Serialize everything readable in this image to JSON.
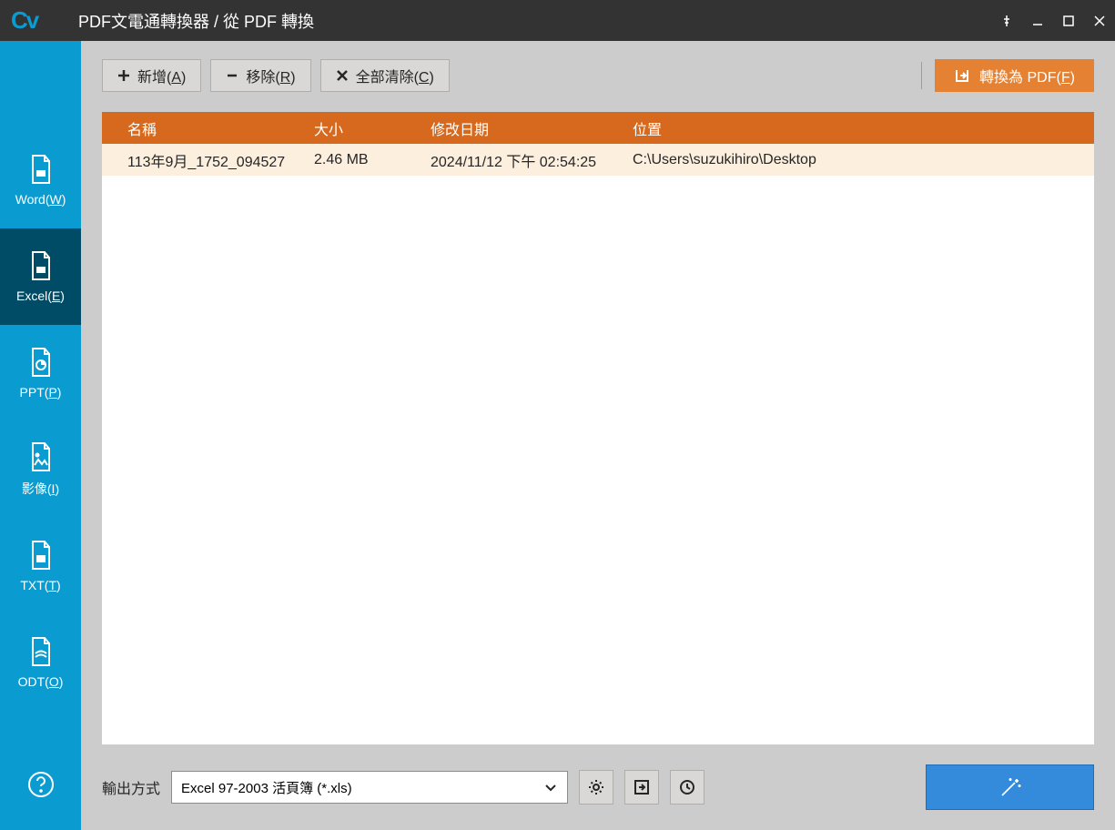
{
  "titlebar": {
    "logo": "Cv",
    "title": "PDF文電通轉換器 / 從 PDF 轉換"
  },
  "sidebar": {
    "items": [
      {
        "label": "Word(",
        "key": "W",
        "tail": ")",
        "icon": "word"
      },
      {
        "label": "Excel(",
        "key": "E",
        "tail": ")",
        "icon": "excel",
        "active": true
      },
      {
        "label": "PPT(",
        "key": "P",
        "tail": ")",
        "icon": "ppt"
      },
      {
        "label": "影像(",
        "key": "I",
        "tail": ")",
        "icon": "image"
      },
      {
        "label": "TXT(",
        "key": "T",
        "tail": ")",
        "icon": "txt"
      },
      {
        "label": "ODT(",
        "key": "O",
        "tail": ")",
        "icon": "odt"
      }
    ]
  },
  "toolbar": {
    "add_pre": "新增(",
    "add_key": "A",
    "add_suf": ")",
    "remove_pre": "移除(",
    "remove_key": "R",
    "remove_suf": ")",
    "clear_pre": "全部清除(",
    "clear_key": "C",
    "clear_suf": ")",
    "convert_pre": "轉換為 PDF(",
    "convert_key": "F",
    "convert_suf": ")"
  },
  "table": {
    "headers": {
      "name": "名稱",
      "size": "大小",
      "date": "修改日期",
      "location": "位置"
    },
    "rows": [
      {
        "name": "113年9月_1752_094527",
        "size": "2.46 MB",
        "date": "2024/11/12 下午 02:54:25",
        "location": "C:\\Users\\suzukihiro\\Desktop"
      }
    ]
  },
  "bottom": {
    "output_label": "輸出方式",
    "format": "Excel 97-2003 活頁簿 (*.xls)"
  }
}
